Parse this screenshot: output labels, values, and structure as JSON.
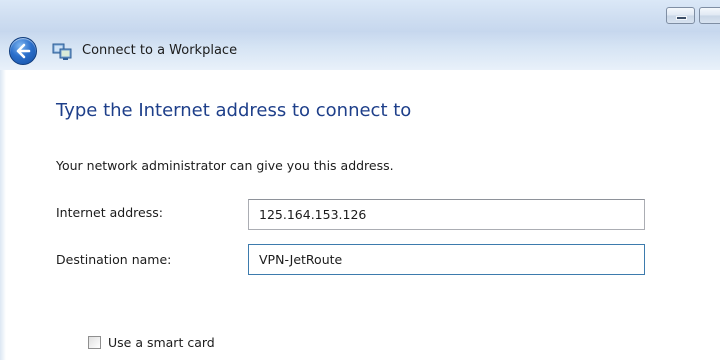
{
  "window": {
    "title": "Connect to a Workplace"
  },
  "page": {
    "heading": "Type the Internet address to connect to",
    "instruction": "Your network administrator can give you this address."
  },
  "form": {
    "internet_address": {
      "label": "Internet address:",
      "value": "125.164.153.126"
    },
    "destination_name": {
      "label": "Destination name:",
      "value": "VPN-JetRoute"
    },
    "smart_card": {
      "label": "Use a smart card",
      "checked": false
    }
  },
  "icons": {
    "back": "back-arrow-icon",
    "app": "network-connection-icon",
    "minimize": "minimize-icon"
  },
  "colors": {
    "heading": "#1e3f8a",
    "titlebar": "#cfdef1"
  }
}
